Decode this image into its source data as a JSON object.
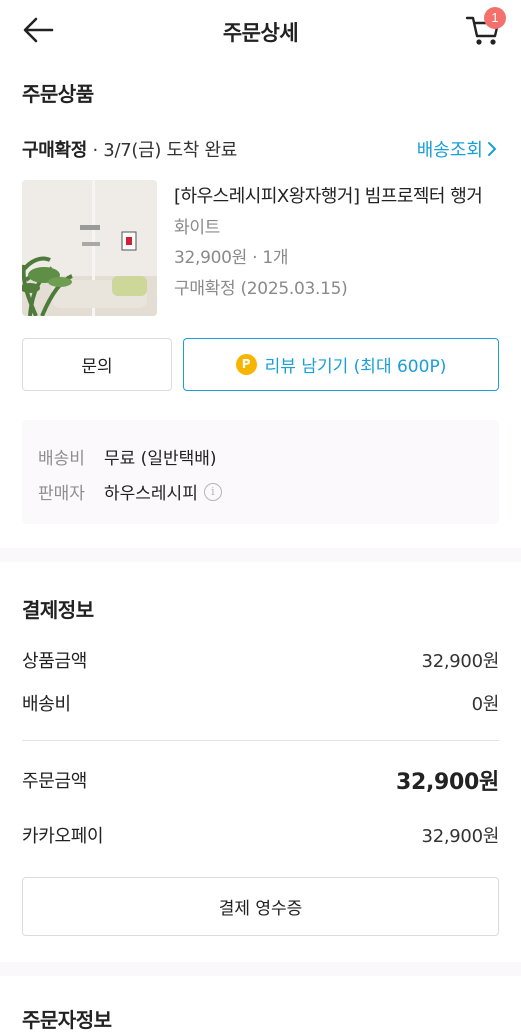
{
  "header": {
    "title": "주문상세",
    "cart_count": "1"
  },
  "order_items": {
    "section_title": "주문상품",
    "status_label": "구매확정",
    "status_detail": " · 3/7(금) 도착 완료",
    "track_label": "배송조회",
    "product": {
      "name": "[하우스레시피X왕자행거] 빔프로젝터 행거",
      "option": "화이트",
      "price_qty": "32,900원 · 1개",
      "confirm_text": "구매확정 (2025.03.15)"
    },
    "inquiry_label": "문의",
    "review_label": "리뷰 남기기 (최대 600P)",
    "point_icon_text": "P",
    "shipping": {
      "fee_label": "배송비",
      "fee_value": "무료 (일반택배)",
      "seller_label": "판매자",
      "seller_value": "하우스레시피"
    }
  },
  "payment": {
    "section_title": "결제정보",
    "rows": [
      {
        "label": "상품금액",
        "value": "32,900원"
      },
      {
        "label": "배송비",
        "value": "0원"
      }
    ],
    "total_label": "주문금액",
    "total_value": "32,900원",
    "method_label": "카카오페이",
    "method_value": "32,900원",
    "receipt_label": "결제 영수증"
  },
  "orderer": {
    "section_title": "주문자정보"
  },
  "colors": {
    "accent": "#1a9fd8",
    "badge": "#f4706c",
    "point": "#f7b500"
  }
}
